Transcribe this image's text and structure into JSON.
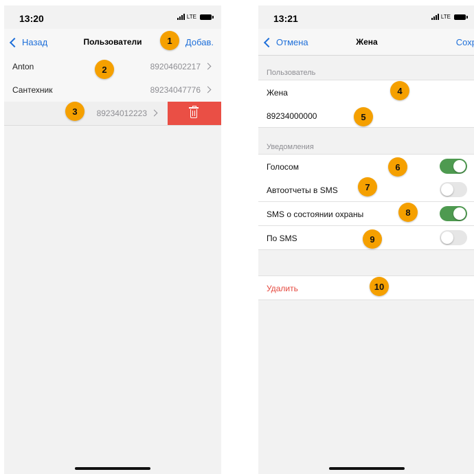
{
  "left_screen": {
    "status": {
      "time": "13:20",
      "network": "LTE"
    },
    "nav": {
      "back": "Назад",
      "title": "Пользователи",
      "add": "Добав."
    },
    "users": [
      {
        "name": "Anton",
        "phone": "89204602217"
      },
      {
        "name": "Сантехник",
        "phone": "89234047776"
      },
      {
        "name": "",
        "phone": "89234012223"
      }
    ]
  },
  "right_screen": {
    "status": {
      "time": "13:21",
      "network": "LTE"
    },
    "nav": {
      "cancel": "Отмена",
      "title": "Жена",
      "save": "Сохр"
    },
    "user_section": {
      "header": "Пользователь",
      "name": "Жена",
      "phone": "89234000000"
    },
    "notifications": {
      "header": "Уведомления",
      "items": [
        {
          "label": "Голосом",
          "on": true
        },
        {
          "label": "Автоотчеты в SMS",
          "on": false
        },
        {
          "label": "SMS о состоянии охраны",
          "on": true
        },
        {
          "label": "По SMS",
          "on": false
        }
      ]
    },
    "delete_label": "Удалить"
  },
  "badges": [
    "1",
    "2",
    "3",
    "4",
    "5",
    "6",
    "7",
    "8",
    "9",
    "10"
  ],
  "colors": {
    "accent": "#1e6fd9",
    "delete": "#ea4f45",
    "toggle_on": "#4e9a50",
    "badge": "#f5a000"
  },
  "icons": [
    "chevron-left-icon",
    "chevron-right-icon",
    "trash-icon",
    "signal-icon",
    "battery-icon"
  ]
}
